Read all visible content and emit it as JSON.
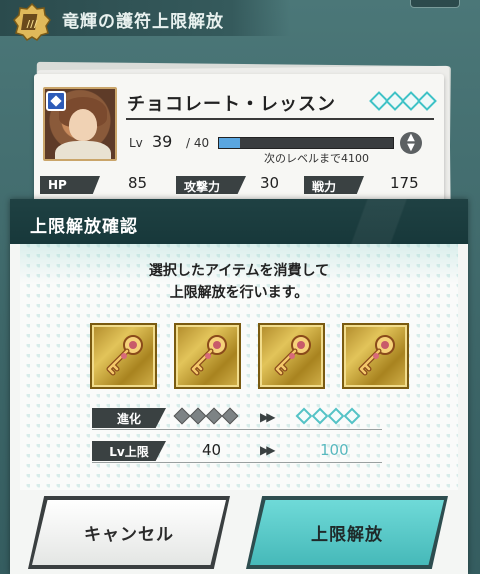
{
  "screen": {
    "title": "竜輝の護符上限解放"
  },
  "character": {
    "name": "チョコレート・レッスン",
    "lv_label": "Lv",
    "level": "39",
    "level_max": "/ 40",
    "exp_fill_fraction": 0.12,
    "exp_text": "次のレベルまで4100",
    "stars": 4,
    "stats": [
      {
        "label": "HP",
        "value": "85"
      },
      {
        "label": "攻撃力",
        "value": "30"
      },
      {
        "label": "戦力",
        "value": "175"
      }
    ]
  },
  "dialog": {
    "title": "上限解放確認",
    "message_line1": "選択したアイテムを消費して",
    "message_line2": "上限解放を行います。",
    "item_count": 4,
    "evolution": {
      "label": "進化",
      "from_stars": 4,
      "to_stars": 4
    },
    "lv_limit": {
      "label": "Lv上限",
      "from": "40",
      "to": "100"
    },
    "cancel_label": "キャンセル",
    "confirm_label": "上限解放"
  },
  "colors": {
    "accent_cyan": "#54c3c6",
    "header_dark": "#1f4143",
    "item_gold": "#d3b24c"
  },
  "icons": {
    "screen_badge": "amulet-badge-icon",
    "item": "ornate-key-icon",
    "element": "element-water-icon"
  }
}
